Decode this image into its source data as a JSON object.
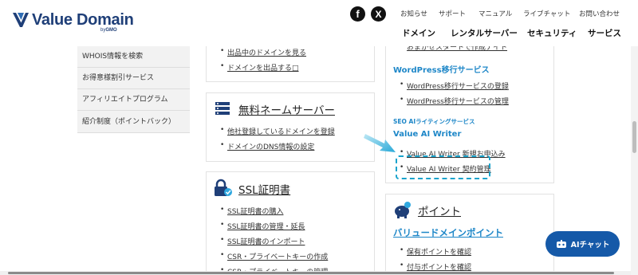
{
  "logo": {
    "text": "Value Domain",
    "by": "by",
    "gmo": "GMO"
  },
  "social": {
    "facebook_glyph": "f",
    "x_glyph": "X"
  },
  "header": {
    "util_links": [
      "お知らせ",
      "サポート",
      "マニュアル",
      "ライブチャット",
      "お問い合わせ"
    ],
    "main_nav": [
      "ドメイン",
      "レンタルサーバー",
      "セキュリティ",
      "サービス"
    ]
  },
  "sidebar": {
    "items": [
      "WHOIS情報を検索",
      "お得意様割引サービス",
      "アフィリエイトプログラム",
      "紹介制度（ポイントバック）"
    ]
  },
  "domain_card": {
    "items": [
      "出品中のドメインを見る",
      "ドメインを出品する□"
    ]
  },
  "nameserver_card": {
    "title": "無料ネームサーバー",
    "items": [
      "他社登録しているドメインを登録",
      "ドメインのDNS情報の設定"
    ]
  },
  "ssl_card": {
    "title": "SSL証明書",
    "items": [
      "SSL証明書の購入",
      "SSL証明書の管理・延長",
      "SSL証明書のインポート",
      "CSR・プライベートキーの作成",
      "CSR・プライベートキーの管理"
    ]
  },
  "services_card": {
    "top_partial": "おまかせスタートで作成ナイト",
    "wp_title": "WordPress移行サービス",
    "wp_items": [
      "WordPress移行サービスの登録",
      "WordPress移行サービスの管理"
    ],
    "ai_section_label": "SEO AIライティングサービス",
    "ai_title": "Value AI Writer",
    "ai_items": [
      "Value AI Writer 新規お申込み",
      "Value AI Writer 契約管理"
    ]
  },
  "points_card": {
    "title": "ポイント",
    "link_title": "バリュードメインポイント",
    "items": [
      "保有ポイントを確認",
      "付与ポイントを確認"
    ]
  },
  "chat_button": {
    "label": "AIチャット"
  },
  "colors": {
    "accent": "#1e87c8",
    "logo": "#1f3f78",
    "chat": "#1559a8",
    "highlight": "#19a3cc"
  }
}
